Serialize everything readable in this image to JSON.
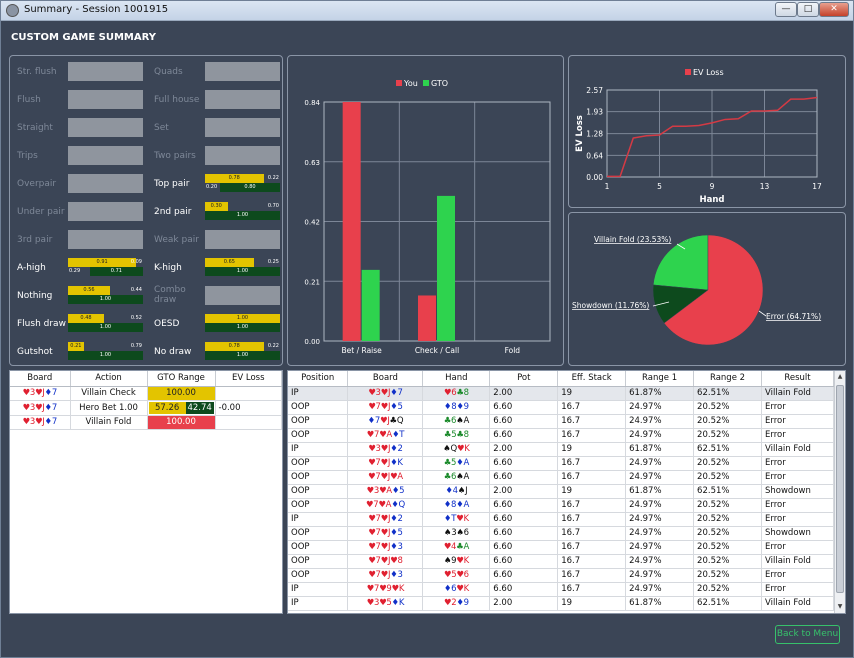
{
  "window": {
    "title": "Summary - Session 1001915",
    "min": "—",
    "max": "□",
    "close": "✕"
  },
  "page_title": "CUSTOM GAME SUMMARY",
  "hand_stats": [
    {
      "label": "Str. flush",
      "active": false
    },
    {
      "label": "Quads",
      "active": false
    },
    {
      "label": "Flush",
      "active": false
    },
    {
      "label": "Full house",
      "active": false
    },
    {
      "label": "Straight",
      "active": false
    },
    {
      "label": "Set",
      "active": false
    },
    {
      "label": "Trips",
      "active": false
    },
    {
      "label": "Two pairs",
      "active": false
    },
    {
      "label": "Overpair",
      "active": false
    },
    {
      "label": "Top pair",
      "active": true,
      "you": 0.78,
      "gto": 0.8,
      "you_label": "0.78",
      "left_label": "0.20",
      "gto_label": "0.80",
      "right_label": "0.22"
    },
    {
      "label": "Under pair",
      "active": false
    },
    {
      "label": "2nd pair",
      "active": true,
      "you": 0.3,
      "gto": 1.0,
      "you_label": "0.30",
      "gto_label": "1.00",
      "right_label": "0.70"
    },
    {
      "label": "3rd pair",
      "active": false
    },
    {
      "label": "Weak pair",
      "active": false
    },
    {
      "label": "A-high",
      "active": true,
      "you": 0.91,
      "gto": 0.71,
      "you_label": "0.91",
      "left_label": "0.29",
      "gto_label": "0.71",
      "right_label": "0.09"
    },
    {
      "label": "K-high",
      "active": true,
      "you": 0.65,
      "gto": 1.0,
      "you_label": "0.65",
      "gto_label": "1.00",
      "right_label": "0.25"
    },
    {
      "label": "Nothing",
      "active": true,
      "you": 0.56,
      "gto": 1.0,
      "you_label": "0.56",
      "gto_label": "1.00",
      "right_label": "0.44"
    },
    {
      "label": "Combo draw",
      "active": false
    },
    {
      "label": "Flush draw",
      "active": true,
      "you": 0.48,
      "gto": 1.0,
      "you_label": "0.48",
      "gto_label": "1.00",
      "right_label": "0.52"
    },
    {
      "label": "OESD",
      "active": true,
      "you": 1.0,
      "gto": 1.0,
      "you_label": "1.00",
      "gto_label": "1.00"
    },
    {
      "label": "Gutshot",
      "active": true,
      "you": 0.21,
      "gto": 1.0,
      "you_label": "0.21",
      "gto_label": "1.00",
      "right_label": "0.79"
    },
    {
      "label": "No draw",
      "active": true,
      "you": 0.78,
      "gto": 1.0,
      "you_label": "0.78",
      "gto_label": "1.00",
      "right_label": "0.22"
    }
  ],
  "bar_chart": {
    "type": "bar",
    "legend": [
      "You",
      "GTO"
    ],
    "categories": [
      "Bet / Raise",
      "Check / Call",
      "Fold"
    ],
    "series": [
      {
        "name": "You",
        "values": [
          0.84,
          0.16,
          0
        ]
      },
      {
        "name": "GTO",
        "values": [
          0.25,
          0.51,
          0
        ]
      }
    ],
    "yticks": [
      "0.00",
      "0.21",
      "0.42",
      "0.63",
      "0.84"
    ],
    "ylim": [
      0,
      0.84
    ],
    "colors": {
      "You": "#e8404c",
      "GTO": "#2ed34e"
    }
  },
  "chart_data": [
    {
      "type": "line",
      "legend": "EV Loss",
      "xlabel": "Hand",
      "ylabel": "EV Loss",
      "x": [
        1,
        2,
        3,
        4,
        5,
        6,
        7,
        8,
        9,
        10,
        11,
        12,
        13,
        14,
        15,
        16,
        17
      ],
      "y": [
        0.02,
        0.02,
        1.15,
        1.22,
        1.24,
        1.5,
        1.5,
        1.52,
        1.6,
        1.7,
        1.72,
        1.95,
        1.95,
        1.97,
        2.3,
        2.3,
        2.35
      ],
      "xticks": [
        "1",
        "5",
        "9",
        "13",
        "17"
      ],
      "yticks": [
        "0.00",
        "0.64",
        "1.28",
        "1.93",
        "2.57"
      ],
      "xlim": [
        1,
        17
      ],
      "ylim": [
        0,
        2.57
      ]
    },
    {
      "type": "pie",
      "slices": [
        {
          "label": "Error (64.71%)",
          "value": 64.71,
          "color": "#e8404c"
        },
        {
          "label": "Villain Fold (23.53%)",
          "value": 23.53,
          "color": "#2ed34e"
        },
        {
          "label": "Showdown (11.76%)",
          "value": 11.76,
          "color": "#0d4a1d"
        }
      ]
    }
  ],
  "actions_table": {
    "headers": [
      "Board",
      "Action",
      "GTO Range",
      "EV Loss"
    ],
    "rows": [
      {
        "board": [
          [
            "3",
            "r",
            "♥"
          ],
          [
            "J",
            "r",
            "♥"
          ],
          [
            "7",
            "b",
            "♦"
          ]
        ],
        "action": "Villain Check",
        "gto": "100.00",
        "gto_type": "y",
        "ev": ""
      },
      {
        "board": [
          [
            "3",
            "r",
            "♥"
          ],
          [
            "J",
            "r",
            "♥"
          ],
          [
            "7",
            "b",
            "♦"
          ]
        ],
        "action": "Hero Bet 1.00",
        "gto": "57.26",
        "gto2": "42.74",
        "gto_type": "split",
        "split": 0.5726,
        "ev": "-0.00"
      },
      {
        "board": [
          [
            "3",
            "r",
            "♥"
          ],
          [
            "J",
            "r",
            "♥"
          ],
          [
            "7",
            "b",
            "♦"
          ]
        ],
        "action": "Villain Fold",
        "gto": "100.00",
        "gto_type": "r",
        "ev": ""
      }
    ]
  },
  "hands_table": {
    "headers": [
      "Position",
      "Board",
      "Hand",
      "Pot",
      "Eff. Stack",
      "Range 1",
      "Range 2",
      "Result"
    ],
    "rows": [
      {
        "pos": "IP",
        "board": [
          [
            "3",
            "r",
            "♥"
          ],
          [
            "J",
            "r",
            "♥"
          ],
          [
            "7",
            "b",
            "♦"
          ]
        ],
        "hand": [
          [
            "6",
            "r",
            "♥"
          ],
          [
            "8",
            "g",
            "♣"
          ]
        ],
        "pot": "2.00",
        "stack": "19",
        "r1": "61.87%",
        "r2": "62.51%",
        "res": "Villain Fold"
      },
      {
        "pos": "OOP",
        "board": [
          [
            "7",
            "r",
            "♥"
          ],
          [
            "J",
            "r",
            "♥"
          ],
          [
            "5",
            "b",
            "♦"
          ]
        ],
        "hand": [
          [
            "8",
            "b",
            "♦"
          ],
          [
            "9",
            "b",
            "♦"
          ]
        ],
        "pot": "6.60",
        "stack": "16.7",
        "r1": "24.97%",
        "r2": "20.52%",
        "res": "Error"
      },
      {
        "pos": "OOP",
        "board": [
          [
            "7",
            "b",
            "♦"
          ],
          [
            "J",
            "r",
            "♥"
          ],
          [
            "Q",
            "k",
            "♣"
          ]
        ],
        "hand": [
          [
            "6",
            "g",
            "♣"
          ],
          [
            "A",
            "k",
            "♠"
          ]
        ],
        "pot": "6.60",
        "stack": "16.7",
        "r1": "24.97%",
        "r2": "20.52%",
        "res": "Error"
      },
      {
        "pos": "OOP",
        "board": [
          [
            "7",
            "r",
            "♥"
          ],
          [
            "A",
            "r",
            "♥"
          ],
          [
            "T",
            "b",
            "♦"
          ]
        ],
        "hand": [
          [
            "5",
            "g",
            "♣"
          ],
          [
            "8",
            "g",
            "♣"
          ]
        ],
        "pot": "6.60",
        "stack": "16.7",
        "r1": "24.97%",
        "r2": "20.52%",
        "res": "Error"
      },
      {
        "pos": "IP",
        "board": [
          [
            "3",
            "r",
            "♥"
          ],
          [
            "J",
            "r",
            "♥"
          ],
          [
            "2",
            "b",
            "♦"
          ]
        ],
        "hand": [
          [
            "Q",
            "k",
            "♠"
          ],
          [
            "K",
            "r",
            "♥"
          ]
        ],
        "pot": "2.00",
        "stack": "19",
        "r1": "61.87%",
        "r2": "62.51%",
        "res": "Villain Fold"
      },
      {
        "pos": "OOP",
        "board": [
          [
            "7",
            "r",
            "♥"
          ],
          [
            "J",
            "r",
            "♥"
          ],
          [
            "K",
            "b",
            "♦"
          ]
        ],
        "hand": [
          [
            "5",
            "g",
            "♣"
          ],
          [
            "A",
            "b",
            "♦"
          ]
        ],
        "pot": "6.60",
        "stack": "16.7",
        "r1": "24.97%",
        "r2": "20.52%",
        "res": "Error"
      },
      {
        "pos": "OOP",
        "board": [
          [
            "7",
            "r",
            "♥"
          ],
          [
            "J",
            "r",
            "♥"
          ],
          [
            "A",
            "r",
            "♥"
          ]
        ],
        "hand": [
          [
            "6",
            "g",
            "♣"
          ],
          [
            "A",
            "k",
            "♠"
          ]
        ],
        "pot": "6.60",
        "stack": "16.7",
        "r1": "24.97%",
        "r2": "20.52%",
        "res": "Error"
      },
      {
        "pos": "OOP",
        "board": [
          [
            "3",
            "r",
            "♥"
          ],
          [
            "A",
            "r",
            "♥"
          ],
          [
            "5",
            "b",
            "♦"
          ]
        ],
        "hand": [
          [
            "4",
            "b",
            "♦"
          ],
          [
            "J",
            "k",
            "♠"
          ]
        ],
        "pot": "2.00",
        "stack": "19",
        "r1": "61.87%",
        "r2": "62.51%",
        "res": "Showdown"
      },
      {
        "pos": "OOP",
        "board": [
          [
            "7",
            "r",
            "♥"
          ],
          [
            "A",
            "r",
            "♥"
          ],
          [
            "Q",
            "b",
            "♦"
          ]
        ],
        "hand": [
          [
            "8",
            "b",
            "♦"
          ],
          [
            "A",
            "b",
            "♦"
          ]
        ],
        "pot": "6.60",
        "stack": "16.7",
        "r1": "24.97%",
        "r2": "20.52%",
        "res": "Error"
      },
      {
        "pos": "IP",
        "board": [
          [
            "7",
            "r",
            "♥"
          ],
          [
            "J",
            "r",
            "♥"
          ],
          [
            "2",
            "b",
            "♦"
          ]
        ],
        "hand": [
          [
            "T",
            "b",
            "♦"
          ],
          [
            "K",
            "r",
            "♥"
          ]
        ],
        "pot": "6.60",
        "stack": "16.7",
        "r1": "24.97%",
        "r2": "20.52%",
        "res": "Error"
      },
      {
        "pos": "OOP",
        "board": [
          [
            "7",
            "r",
            "♥"
          ],
          [
            "J",
            "r",
            "♥"
          ],
          [
            "5",
            "b",
            "♦"
          ]
        ],
        "hand": [
          [
            "3",
            "k",
            "♠"
          ],
          [
            "6",
            "k",
            "♠"
          ]
        ],
        "pot": "6.60",
        "stack": "16.7",
        "r1": "24.97%",
        "r2": "20.52%",
        "res": "Showdown"
      },
      {
        "pos": "OOP",
        "board": [
          [
            "7",
            "r",
            "♥"
          ],
          [
            "J",
            "r",
            "♥"
          ],
          [
            "3",
            "b",
            "♦"
          ]
        ],
        "hand": [
          [
            "4",
            "r",
            "♥"
          ],
          [
            "A",
            "g",
            "♣"
          ]
        ],
        "pot": "6.60",
        "stack": "16.7",
        "r1": "24.97%",
        "r2": "20.52%",
        "res": "Error"
      },
      {
        "pos": "OOP",
        "board": [
          [
            "7",
            "r",
            "♥"
          ],
          [
            "J",
            "r",
            "♥"
          ],
          [
            "8",
            "r",
            "♥"
          ]
        ],
        "hand": [
          [
            "9",
            "k",
            "♠"
          ],
          [
            "K",
            "r",
            "♥"
          ]
        ],
        "pot": "6.60",
        "stack": "16.7",
        "r1": "24.97%",
        "r2": "20.52%",
        "res": "Villain Fold"
      },
      {
        "pos": "OOP",
        "board": [
          [
            "7",
            "r",
            "♥"
          ],
          [
            "J",
            "r",
            "♥"
          ],
          [
            "3",
            "b",
            "♦"
          ]
        ],
        "hand": [
          [
            "5",
            "r",
            "♥"
          ],
          [
            "6",
            "r",
            "♥"
          ]
        ],
        "pot": "6.60",
        "stack": "16.7",
        "r1": "24.97%",
        "r2": "20.52%",
        "res": "Error"
      },
      {
        "pos": "IP",
        "board": [
          [
            "7",
            "r",
            "♥"
          ],
          [
            "9",
            "r",
            "♥"
          ],
          [
            "K",
            "r",
            "♥"
          ]
        ],
        "hand": [
          [
            "6",
            "b",
            "♦"
          ],
          [
            "K",
            "r",
            "♥"
          ]
        ],
        "pot": "6.60",
        "stack": "16.7",
        "r1": "24.97%",
        "r2": "20.52%",
        "res": "Error"
      },
      {
        "pos": "IP",
        "board": [
          [
            "3",
            "r",
            "♥"
          ],
          [
            "5",
            "r",
            "♥"
          ],
          [
            "K",
            "b",
            "♦"
          ]
        ],
        "hand": [
          [
            "2",
            "r",
            "♥"
          ],
          [
            "9",
            "b",
            "♦"
          ]
        ],
        "pot": "2.00",
        "stack": "19",
        "r1": "61.87%",
        "r2": "62.51%",
        "res": "Villain Fold"
      }
    ]
  },
  "scroll": {
    "up": "▲",
    "down": "▼"
  },
  "back_button": "Back to Menu"
}
